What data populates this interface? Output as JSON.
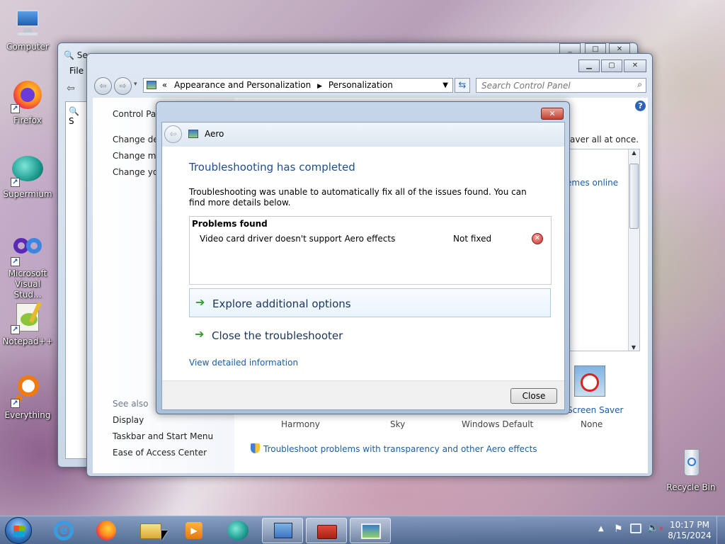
{
  "desktop": {
    "icons": [
      "Computer",
      "Firefox",
      "Supermium",
      "Microsoft Visual Stud...",
      "Notepad++",
      "Everything",
      "Recycle Bin"
    ]
  },
  "back_window": {
    "menu_file": "File",
    "side_item": "S",
    "title_frag": "Se"
  },
  "control_panel": {
    "breadcrumb": {
      "sep": "«",
      "part1": "Appearance and Personalization",
      "part2": "Personalization"
    },
    "search_placeholder": "Search Control Panel",
    "left": {
      "home": "Control Pan",
      "links": [
        "Change des",
        "Change mo",
        "Change you"
      ],
      "see_also": "See also",
      "see_also_links": [
        "Display",
        "Taskbar and Start Menu",
        "Ease of Access Center"
      ]
    },
    "main": {
      "frag_text": "aver all at once.",
      "themes_online": "emes online",
      "screen_saver_label": "Screen Saver",
      "screen_saver_value": "None",
      "themes": [
        "Harmony",
        "Sky",
        "Windows Default"
      ],
      "troubleshoot_link": "Troubleshoot problems with transparency and other Aero effects"
    }
  },
  "dialog": {
    "title": "Aero",
    "heading": "Troubleshooting has completed",
    "description": "Troubleshooting was unable to automatically fix all of the issues found. You can find more details below.",
    "problems_header": "Problems found",
    "problems": [
      {
        "name": "Video card driver doesn't support Aero effects",
        "status": "Not fixed"
      }
    ],
    "option1": "Explore additional options",
    "option2": "Close the troubleshooter",
    "details_link": "View detailed information",
    "close_button": "Close"
  },
  "taskbar": {
    "time": "10:17 PM",
    "date": "8/15/2024"
  },
  "colors": {
    "link": "#1a5da8",
    "heading": "#1e4e8c",
    "arrow": "#2e9e2e",
    "error": "#c9302c"
  }
}
